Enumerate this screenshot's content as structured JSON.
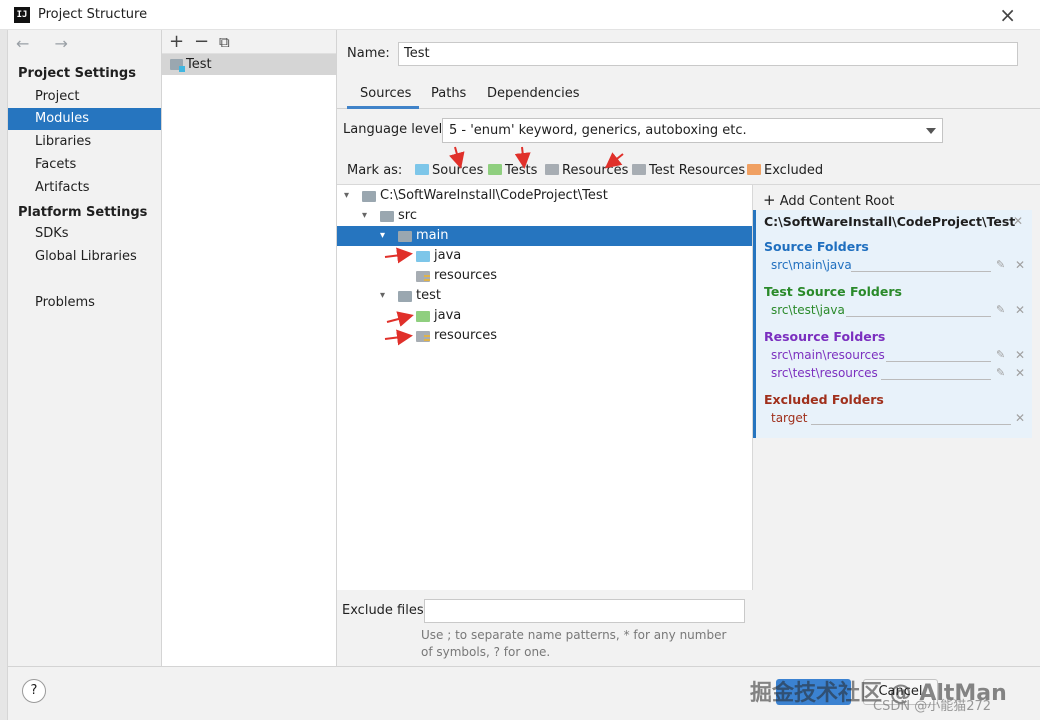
{
  "window": {
    "title": "Project Structure",
    "logo": "IJ"
  },
  "nav": {
    "arrows": "← →",
    "project_settings_heading": "Project Settings",
    "platform_settings_heading": "Platform Settings",
    "items": {
      "project": "Project",
      "modules": "Modules",
      "libraries": "Libraries",
      "facets": "Facets",
      "artifacts": "Artifacts",
      "sdks": "SDKs",
      "global_libraries": "Global Libraries",
      "problems": "Problems"
    },
    "selected": "Modules"
  },
  "modules": {
    "toolbar": {
      "add": "+",
      "remove": "−",
      "copy": "⧉"
    },
    "items": [
      "Test"
    ]
  },
  "main": {
    "name_label": "Name:",
    "name_value": "Test",
    "tabs": [
      "Sources",
      "Paths",
      "Dependencies"
    ],
    "active_tab": "Sources",
    "language_level_label": "Language level:",
    "language_level_value": "5 - 'enum' keyword, generics, autoboxing etc.",
    "mark_as_label": "Mark as:",
    "mark_as": {
      "sources": "Sources",
      "tests": "Tests",
      "resources": "Resources",
      "test_resources": "Test Resources",
      "excluded": "Excluded"
    },
    "tree": {
      "root": "C:\\SoftWareInstall\\CodeProject\\Test",
      "src": "src",
      "main": "main",
      "main_java": "java",
      "main_resources": "resources",
      "test": "test",
      "test_java": "java",
      "test_resources": "resources",
      "selected": "main"
    },
    "exclude_files_label": "Exclude files:",
    "exclude_files_value": "",
    "exclude_hint": "Use ; to separate name patterns, * for any number of symbols, ? for one."
  },
  "content_roots": {
    "add_label": "Add Content Root",
    "root_path": "C:\\SoftWareInstall\\CodeProject\\Test",
    "source_folders_heading": "Source Folders",
    "source_folders": [
      "src\\main\\java"
    ],
    "test_source_folders_heading": "Test Source Folders",
    "test_source_folders": [
      "src\\test\\java"
    ],
    "resource_folders_heading": "Resource Folders",
    "resource_folders": [
      "src\\main\\resources",
      "src\\test\\resources"
    ],
    "excluded_folders_heading": "Excluded Folders",
    "excluded_folders": [
      "target"
    ]
  },
  "footer": {
    "help": "?",
    "cancel_label": "Cancel",
    "watermark": "掘金技术社区 @ AltMan",
    "watermark_small": "CSDN @小能猫272"
  },
  "colors": {
    "selection": "#2675bf",
    "source_folder": "#7dc6e9",
    "test_folder": "#8fcf7f",
    "excluded_folder": "#f0a062",
    "source_heading": "#1f6fbf",
    "test_heading": "#2a8a2a",
    "resource_heading": "#7b2fbf",
    "excluded_heading": "#a0301c",
    "arrow": "#e0302a"
  }
}
